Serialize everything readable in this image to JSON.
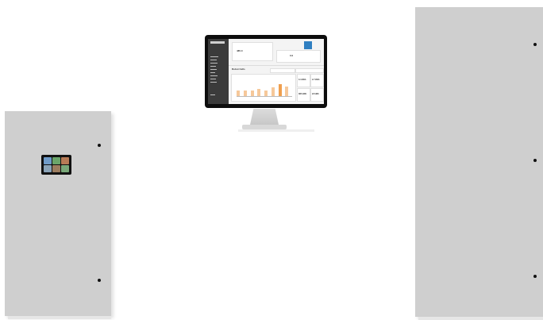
{
  "colors": {
    "cabinet": "#cfcfcf",
    "monitor_bezel": "#0d0d0d",
    "sidebar": "#3b3b3b",
    "accent": "#2f7fc1",
    "bar_light": "#f6c89a",
    "bar_dark": "#ef9f4f"
  },
  "hmi_tiles": [
    "#6f9bc9",
    "#6aa56a",
    "#b77b56",
    "#8aa3b8",
    "#9c7d5f",
    "#79a879"
  ],
  "dashboard": {
    "stat1_value": "485.0",
    "stat2_value": "0.0",
    "section_title": "Robot Cells",
    "tile_values": [
      "3.4 kWh",
      "2.7 kWh",
      "385 kWh",
      "22 kWh"
    ],
    "bars": [
      0.3,
      0.3,
      0.3,
      0.4,
      0.3,
      0.5,
      0.7,
      0.55
    ]
  }
}
